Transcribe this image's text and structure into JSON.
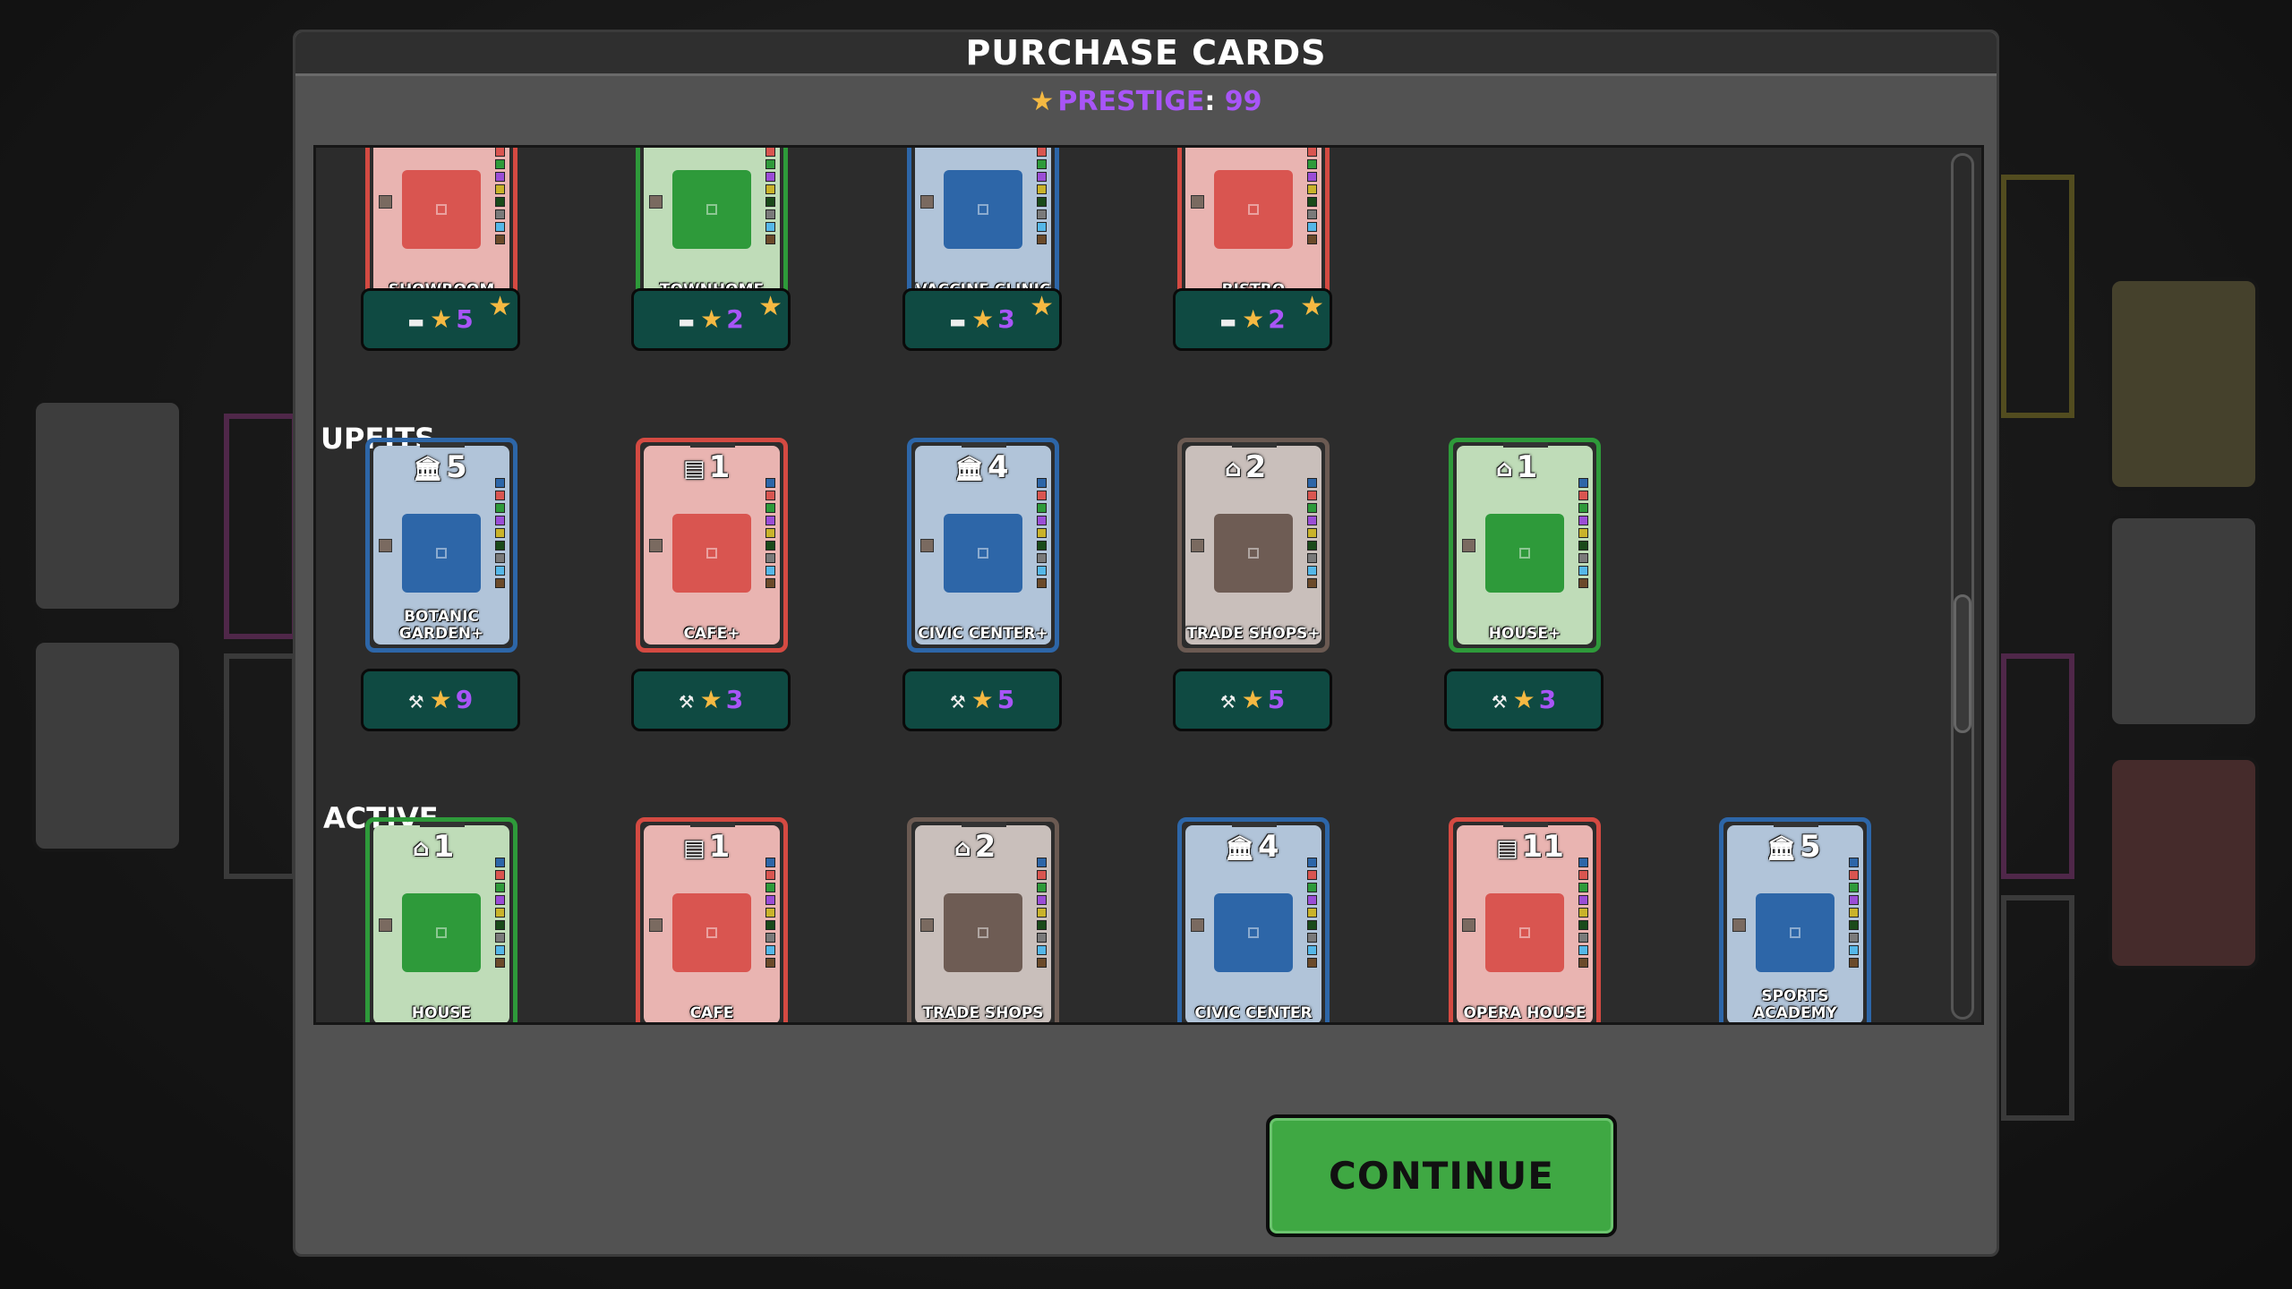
{
  "dialog": {
    "title": "PURCHASE CARDS",
    "prestige_label": "PRESTIGE",
    "prestige_value": "99"
  },
  "sections": {
    "upfits": "UPFITS",
    "active": "ACTIVE"
  },
  "top_row": [
    {
      "name": "SHOWROOM",
      "theme": "red",
      "price": "5"
    },
    {
      "name": "TOWNHOME",
      "theme": "green",
      "price": "2"
    },
    {
      "name": "VACCINE CLINIC",
      "theme": "blue",
      "price": "3"
    },
    {
      "name": "BISTRO",
      "theme": "red",
      "price": "2"
    }
  ],
  "upfits": [
    {
      "name": "BOTANIC GARDEN+",
      "theme": "blue",
      "number": "5",
      "icon": "bank-icon",
      "price": "9"
    },
    {
      "name": "CAFE+",
      "theme": "red",
      "number": "1",
      "icon": "storefront-icon",
      "price": "3"
    },
    {
      "name": "CIVIC CENTER+",
      "theme": "blue",
      "number": "4",
      "icon": "bank-icon",
      "price": "5"
    },
    {
      "name": "TRADE SHOPS+",
      "theme": "brown",
      "number": "2",
      "icon": "factory-icon",
      "price": "5"
    },
    {
      "name": "HOUSE+",
      "theme": "green",
      "number": "1",
      "icon": "house-icon",
      "price": "3"
    }
  ],
  "active": [
    {
      "name": "HOUSE",
      "theme": "green",
      "number": "1",
      "icon": "house-icon"
    },
    {
      "name": "CAFE",
      "theme": "red",
      "number": "1",
      "icon": "storefront-icon"
    },
    {
      "name": "TRADE SHOPS",
      "theme": "brown",
      "number": "2",
      "icon": "factory-icon"
    },
    {
      "name": "CIVIC CENTER",
      "theme": "blue",
      "number": "4",
      "icon": "bank-icon"
    },
    {
      "name": "OPERA HOUSE",
      "theme": "red",
      "number": "11",
      "icon": "storefront-icon"
    },
    {
      "name": "SPORTS ACADEMY",
      "theme": "blue",
      "number": "5",
      "icon": "bank-icon"
    }
  ],
  "continue_label": "CONTINUE",
  "colors": {
    "dialog_bg": "#525252",
    "price_bg": "#0f4a42",
    "prestige": "#a855f7",
    "star": "#f5b942",
    "continue": "#3fa843"
  }
}
